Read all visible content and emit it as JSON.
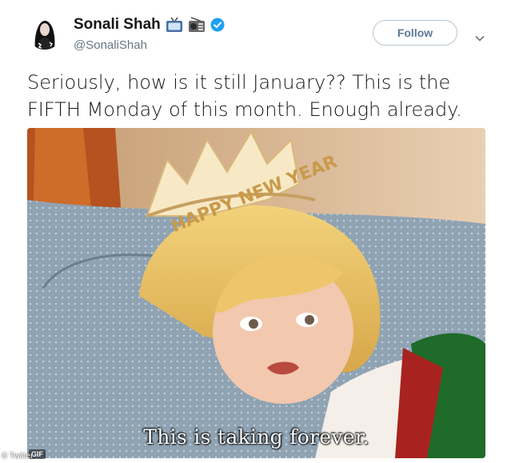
{
  "user": {
    "display_name": "Sonali Shah",
    "handle": "@SonaliShah",
    "verified": true,
    "name_emojis": [
      "tv-icon",
      "radio-icon"
    ]
  },
  "follow_button": {
    "label": "Follow"
  },
  "tweet": {
    "text": "Seriously, how is it still January?? This is the FIFTH Monday of this month. Enough already."
  },
  "media": {
    "type": "GIF",
    "badge_label": "GIF",
    "caption": "This is taking forever.",
    "tiara_text": "HAPPY NEW YEAR"
  },
  "image_credit": "© Twitter",
  "colors": {
    "verified_blue": "#1da1f2",
    "follow_text": "#5c7a96",
    "handle_gray": "#657786"
  }
}
